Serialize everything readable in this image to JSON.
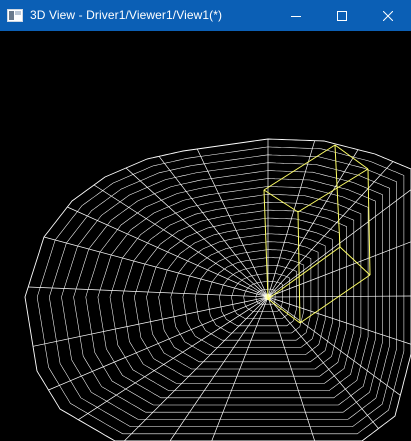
{
  "window": {
    "title": "3D View - Driver1/Viewer1/View1(*)",
    "controls": {
      "minimize": "minimize",
      "maximize": "maximize",
      "close": "close"
    }
  },
  "viewport": {
    "background": "#000000",
    "disk_color": "#ffffff",
    "box_color": "#ffff66",
    "disk": {
      "radial_segments": 24,
      "rings": 20
    }
  },
  "colors": {
    "titlebar": "#0b5fb5",
    "title_text": "#ffffff"
  },
  "icons": {
    "app": "app-window-icon",
    "minimize": "minimize-icon",
    "maximize": "maximize-icon",
    "close": "close-icon"
  }
}
